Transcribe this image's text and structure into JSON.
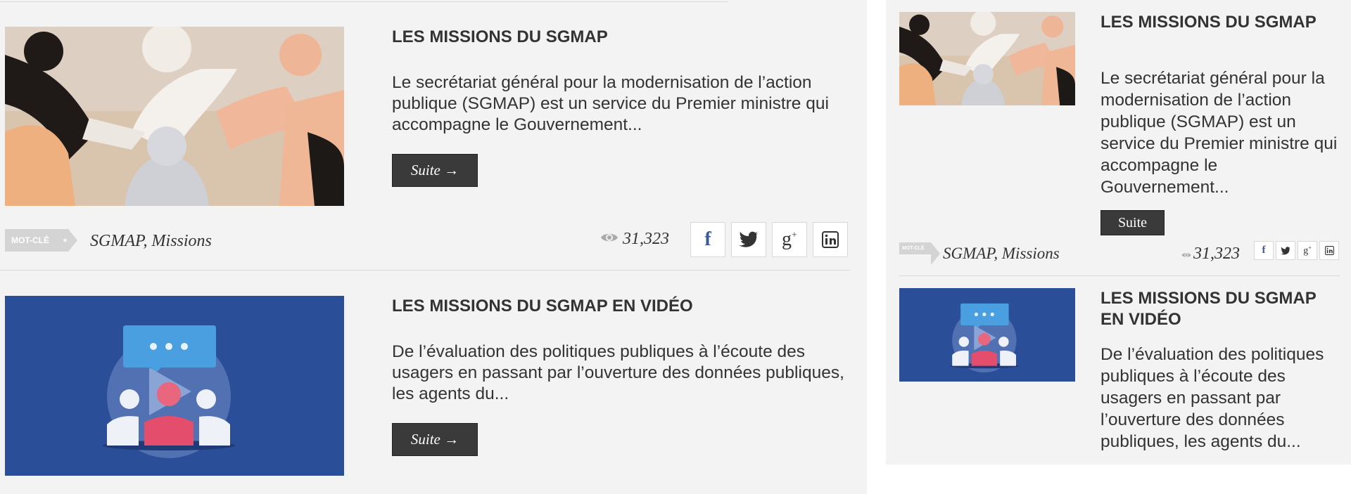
{
  "articles": [
    {
      "title": "LES MISSIONS DU SGMAP",
      "excerpt": "Le secrétariat général pour la modernisation de l’action publique (SGMAP) est un service du Premier ministre qui accompagne le Gouvernement...",
      "button_label": "Suite →",
      "tag_badge": "MOT-CLÉ",
      "tags": "SGMAP, Missions",
      "views": "31,323",
      "share": [
        "facebook-icon",
        "twitter-icon",
        "google-plus-icon",
        "linkedin-icon"
      ]
    },
    {
      "title": "LES MISSIONS DU SGMAP EN VIDÉO",
      "excerpt": "De l’évaluation des politiques publiques à l’écoute des usagers en passant par l’ouverture des données publiques, les agents du...",
      "button_label": "Suite →"
    }
  ],
  "sidebar": {
    "articles": [
      {
        "title": "LES MISSIONS DU SGMAP",
        "excerpt": "Le secrétariat général pour la modernisation de l’action publique (SGMAP) est un service du Premier ministre qui accompagne le Gouvernement...",
        "button_label": "Suite",
        "tag_badge": "MOT-CLÉ",
        "tags": "SGMAP, Missions",
        "views": "31,323"
      },
      {
        "title": "LES MISSIONS DU SGMAP EN VIDÉO",
        "excerpt": "De l’évaluation des politiques publiques à l’écoute des usagers en passant par l’ouverture des données publiques, les agents du..."
      }
    ]
  },
  "colors": {
    "background": "#f3f3f3",
    "button": "#3a3a3a",
    "video_thumb_bg": "#2a4f98",
    "tag_badge": "#d4d4d4"
  }
}
